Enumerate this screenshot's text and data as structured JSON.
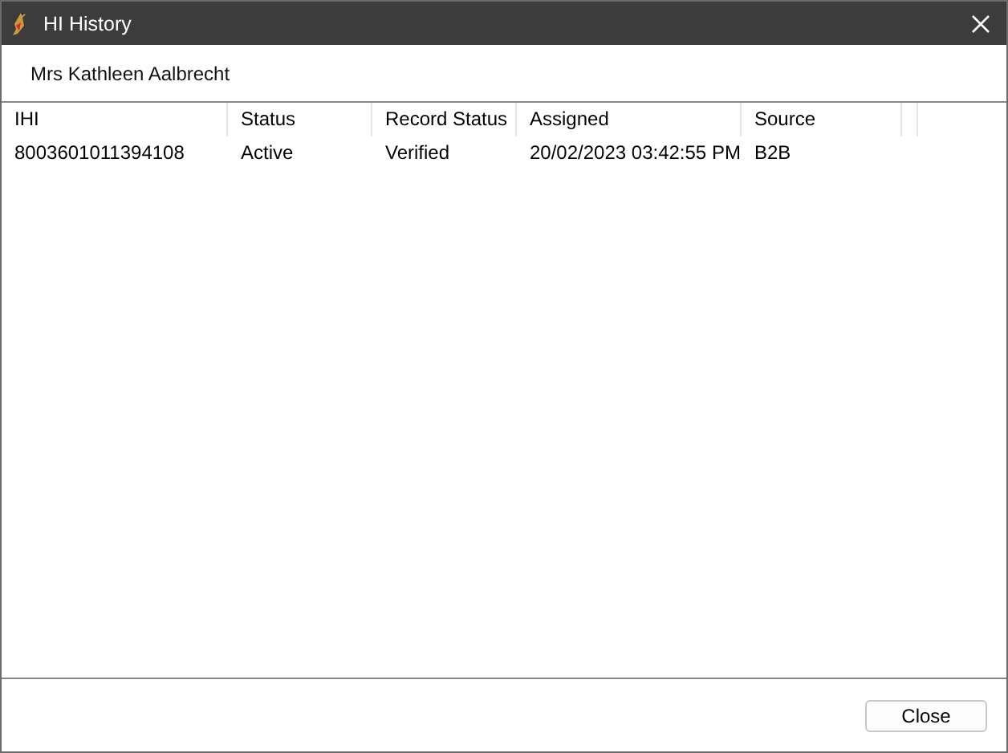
{
  "window": {
    "title": "HI History"
  },
  "patient": "Mrs Kathleen Aalbrecht",
  "table": {
    "columns": [
      "IHI",
      "Status",
      "Record Status",
      "Assigned",
      "Source"
    ],
    "rows": [
      [
        "8003601011394108",
        "Active",
        "Verified",
        "20/02/2023 03:42:55 PM",
        "B2B"
      ]
    ]
  },
  "buttons": [
    "Close"
  ]
}
